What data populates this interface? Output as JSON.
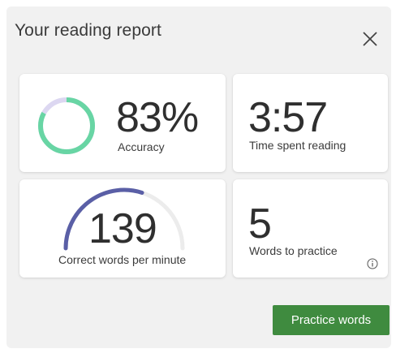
{
  "header": {
    "title": "Your reading report"
  },
  "stats": {
    "accuracy": {
      "value": "83%",
      "label": "Accuracy",
      "fraction": 0.83
    },
    "time": {
      "value": "3:57",
      "label": "Time spent reading"
    },
    "wpm": {
      "value": "139",
      "label": "Correct words per minute"
    },
    "words": {
      "value": "5",
      "label": "Words to practice"
    }
  },
  "actions": {
    "practice_label": "Practice words"
  },
  "colors": {
    "accuracy_ring": "#68d5a4",
    "accuracy_ring_track": "#dcd7f1",
    "wpm_arc": "#5a5fa6",
    "wpm_arc_track": "#ececec",
    "practice_button": "#3f8b3f"
  },
  "icons": {
    "close": "close-icon",
    "info": "info-icon"
  }
}
